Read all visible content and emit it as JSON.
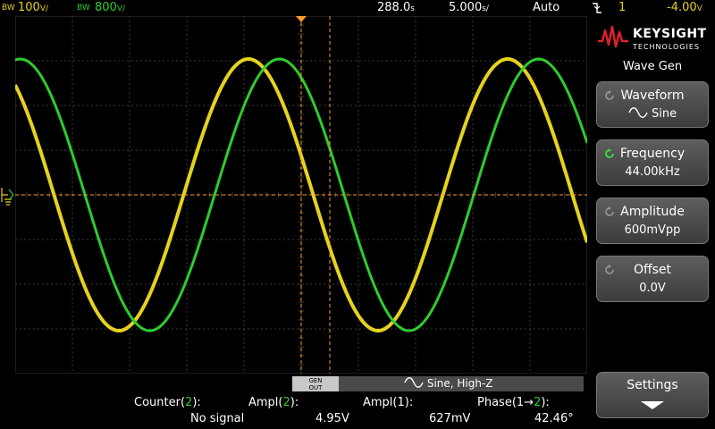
{
  "topbar": {
    "ch1_bw_badge": "BW",
    "ch1_scale": "100",
    "ch1_unit": "V/",
    "ch2_bw_badge": "BW",
    "ch2_scale": "800",
    "ch2_unit": "V/",
    "delay": "288.0",
    "delay_unit": "s",
    "timebase": "5.000",
    "timebase_unit": "s/",
    "trigger_mode": "Auto",
    "trigger_source": "1",
    "trigger_level": "-4.00",
    "trigger_level_unit": "V"
  },
  "brand": {
    "name": "KEYSIGHT",
    "sub": "TECHNOLOGIES",
    "color": "#e0202a"
  },
  "menu": {
    "title": "Wave Gen",
    "softkeys": [
      {
        "label": "Waveform",
        "value": "Sine"
      },
      {
        "label": "Frequency",
        "value": "44.00kHz"
      },
      {
        "label": "Amplitude",
        "value": "600mVpp"
      },
      {
        "label": "Offset",
        "value": "0.0V"
      }
    ],
    "settings_label": "Settings"
  },
  "gen": {
    "out_line1": "GEN",
    "out_line2": "OUT",
    "info": "Sine, High-Z"
  },
  "measurements": {
    "counter_label": "Counter(",
    "counter_ch": "2",
    "counter_close": "):",
    "counter_value": "No signal",
    "ampl2_label": "Ampl(",
    "ampl2_ch": "2",
    "ampl2_close": "):",
    "ampl2_value": "4.95V",
    "ampl1_label": "Ampl(1):",
    "ampl1_value": "627mV",
    "phase_label": "Phase(1→",
    "phase_ch": "2",
    "phase_close": "):",
    "phase_value": "42.46°"
  },
  "colors": {
    "ch1": "#e6d21e",
    "ch2": "#2ecc2e",
    "cursor": "#ff9a2a",
    "grid": "#3a3a3a"
  },
  "icons": [
    "falling-edge-trigger-icon",
    "sine-wave-icon",
    "entry-knob-icon",
    "down-arrow-icon",
    "trigger-marker-icon",
    "ground-marker-icon"
  ]
}
